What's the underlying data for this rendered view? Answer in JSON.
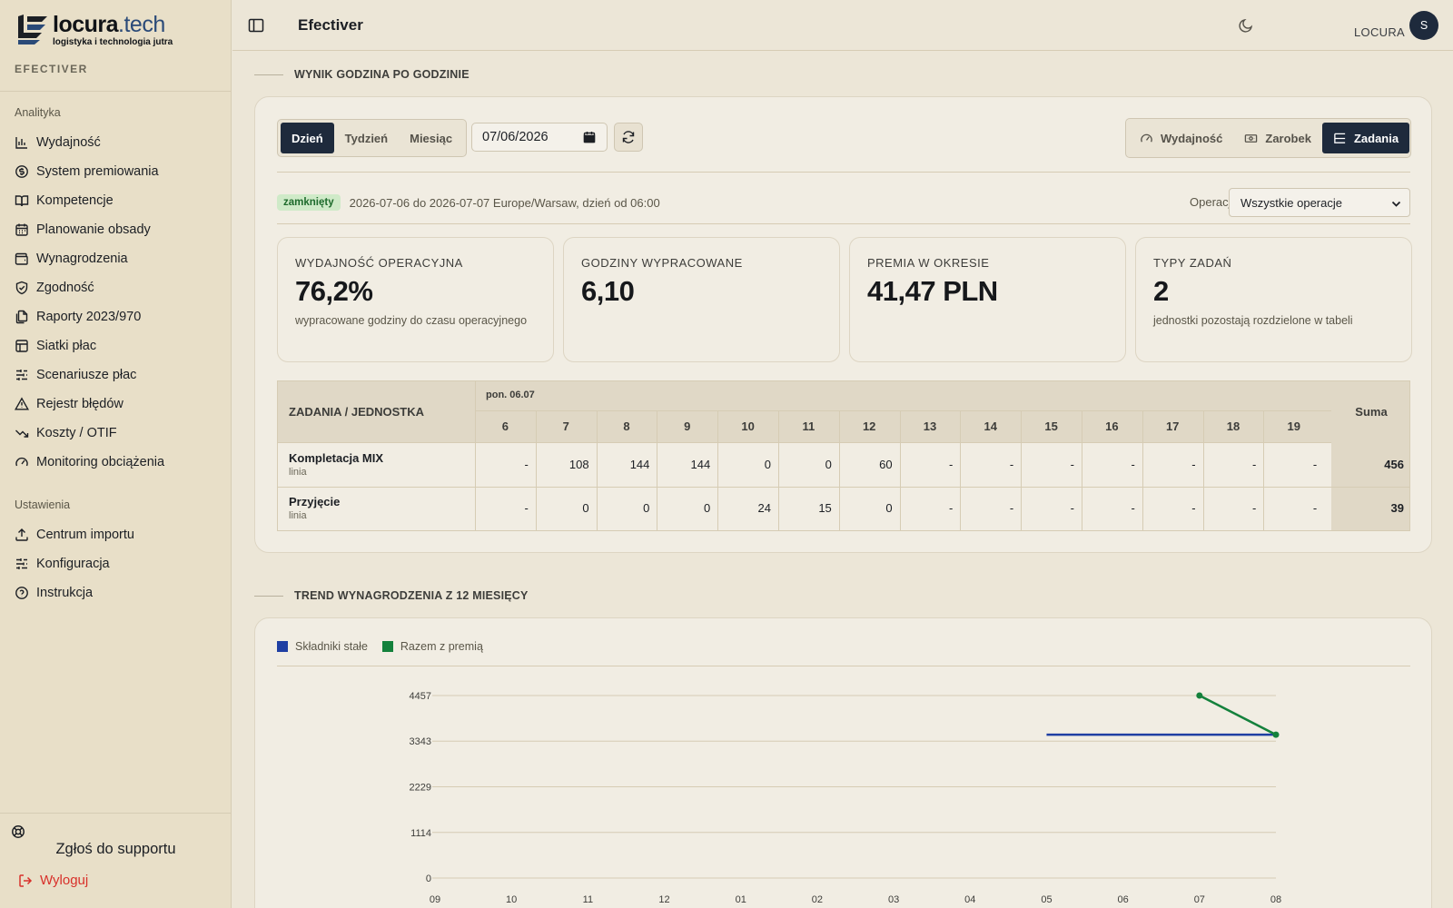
{
  "brand": {
    "name": "locura",
    "tld": ".tech",
    "tagline": "logistyka i technologia jutra",
    "app_label": "EFECTIVER"
  },
  "sidebar": {
    "section_analytics": "Analityka",
    "items": [
      {
        "label": "Wydajność",
        "icon": "bar-chart-icon"
      },
      {
        "label": "System premiowania",
        "icon": "coin-icon"
      },
      {
        "label": "Kompetencje",
        "icon": "book-icon"
      },
      {
        "label": "Planowanie obsady",
        "icon": "calendar-icon"
      },
      {
        "label": "Wynagrodzenia",
        "icon": "wallet-icon"
      },
      {
        "label": "Zgodność",
        "icon": "shield-icon"
      },
      {
        "label": "Raporty 2023/970",
        "icon": "files-icon"
      },
      {
        "label": "Siatki płac",
        "icon": "grid-table-icon"
      },
      {
        "label": "Scenariusze płac",
        "icon": "sliders-icon"
      },
      {
        "label": "Rejestr błędów",
        "icon": "warning-icon"
      },
      {
        "label": "Koszty / OTIF",
        "icon": "trend-icon"
      },
      {
        "label": "Monitoring obciążenia",
        "icon": "gauge-icon"
      }
    ],
    "section_settings": "Ustawienia",
    "settings_items": [
      {
        "label": "Centrum importu",
        "icon": "upload-icon"
      },
      {
        "label": "Konfiguracja",
        "icon": "sliders-icon"
      },
      {
        "label": "Instrukcja",
        "icon": "help-icon"
      }
    ],
    "support": "Zgłoś do supportu",
    "logout": "Wyloguj"
  },
  "topbar": {
    "title": "Efectiver",
    "org": "LOCURA",
    "avatar_initial": "S"
  },
  "section1": {
    "title": "WYNIK GODZINA PO GODZINIE",
    "range_tabs": [
      "Dzień",
      "Tydzień",
      "Miesiąc"
    ],
    "active_range": "Dzień",
    "date_value": "07/06/2026",
    "metric_tabs": [
      "Wydajność",
      "Zarobek",
      "Zadania"
    ],
    "active_metric": "Zadania",
    "status_badge": "zamknięty",
    "period_text": "2026-07-06 do 2026-07-07  Europe/Warsaw, dzień od 06:00",
    "operation_label": "Operacja",
    "operation_value": "Wszystkie operacje",
    "kpis": [
      {
        "label": "WYDAJNOŚĆ OPERACYJNA",
        "value": "76,2%",
        "desc": "wypracowane godziny do czasu operacyjnego"
      },
      {
        "label": "GODZINY WYPRACOWANE",
        "value": "6,10",
        "desc": ""
      },
      {
        "label": "PREMIA W OKRESIE",
        "value": "41,47 PLN",
        "desc": ""
      },
      {
        "label": "TYPY ZADAŃ",
        "value": "2",
        "desc": "jednostki pozostają rozdzielone w tabeli"
      }
    ],
    "table": {
      "corner": "ZADANIA / JEDNOSTKA",
      "day_label": "pon. 06.07",
      "hours": [
        "6",
        "7",
        "8",
        "9",
        "10",
        "11",
        "12",
        "13",
        "14",
        "15",
        "16",
        "17",
        "18",
        "19"
      ],
      "sum_label": "Suma",
      "rows": [
        {
          "name": "Kompletacja MIX",
          "unit": "linia",
          "values": [
            "-",
            "108",
            "144",
            "144",
            "0",
            "0",
            "60",
            "-",
            "-",
            "-",
            "-",
            "-",
            "-",
            "-"
          ],
          "sum": "456"
        },
        {
          "name": "Przyjęcie",
          "unit": "linia",
          "values": [
            "-",
            "0",
            "0",
            "0",
            "24",
            "15",
            "0",
            "-",
            "-",
            "-",
            "-",
            "-",
            "-",
            "-"
          ],
          "sum": "39"
        }
      ]
    }
  },
  "section2": {
    "title": "TREND WYNAGRODZENIA Z 12 MIESIĘCY",
    "legend": [
      {
        "name": "Składniki stałe",
        "color": "#1f3fa3"
      },
      {
        "name": "Razem z premią",
        "color": "#14813c"
      }
    ]
  },
  "chart_data": {
    "type": "line",
    "x": [
      "09",
      "10",
      "11",
      "12",
      "01",
      "02",
      "03",
      "04",
      "05",
      "06",
      "07",
      "08"
    ],
    "yticks": [
      0,
      1114,
      2229,
      3343,
      4457
    ],
    "ylim": [
      0,
      4457
    ],
    "grid": true,
    "legend_position": "top-left",
    "series": [
      {
        "name": "Składniki stałe",
        "color": "#1f3fa3",
        "values": [
          null,
          null,
          null,
          null,
          null,
          null,
          null,
          null,
          3500,
          3500,
          3500,
          3500
        ]
      },
      {
        "name": "Razem z premią",
        "color": "#14813c",
        "values": [
          null,
          null,
          null,
          null,
          null,
          null,
          null,
          null,
          null,
          null,
          4457,
          3500
        ]
      }
    ]
  }
}
